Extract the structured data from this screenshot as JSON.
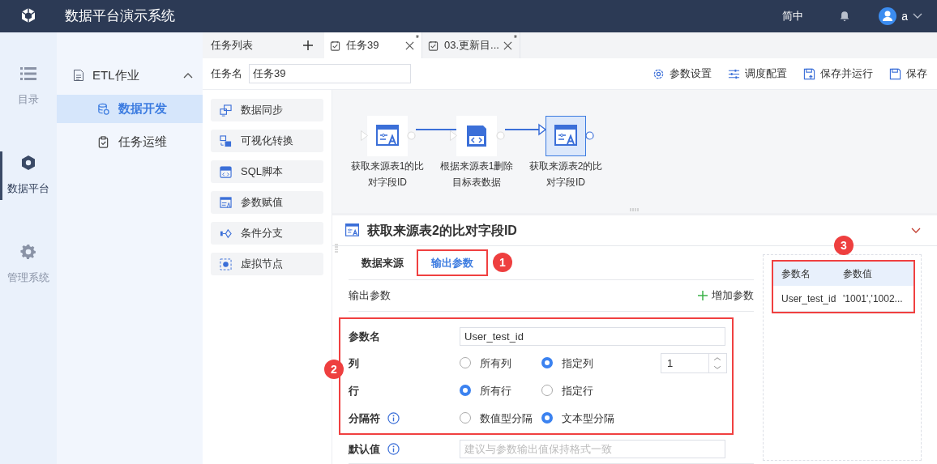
{
  "header": {
    "title": "数据平台演示系统",
    "language": "简中",
    "user": "a"
  },
  "rail": [
    {
      "label": "目录",
      "selected": false
    },
    {
      "label": "数据平台",
      "selected": true
    },
    {
      "label": "管理系统",
      "selected": false
    }
  ],
  "nav": {
    "group": {
      "label": "ETL作业",
      "expanded": true
    },
    "items": [
      {
        "label": "数据开发",
        "selected": true
      },
      {
        "label": "任务运维",
        "selected": false
      }
    ]
  },
  "tab_bar": {
    "list_label": "任务列表",
    "tabs": [
      {
        "label": "任务39",
        "selected": true,
        "mark": "*"
      },
      {
        "label": "03.更新目...",
        "selected": false,
        "mark": "*"
      }
    ]
  },
  "task_name": {
    "label": "任务名",
    "value": "任务39"
  },
  "toolbar": [
    "参数设置",
    "调度配置",
    "保存并运行",
    "保存"
  ],
  "palette": [
    "数据同步",
    "可视化转换",
    "SQL脚本",
    "参数赋值",
    "条件分支",
    "虚拟节点"
  ],
  "flow": {
    "nodes": [
      {
        "label": "获取来源表1的比对字段ID",
        "kind": "assign",
        "selected": false
      },
      {
        "label": "根据来源表1删除目标表数据",
        "kind": "sql",
        "selected": false
      },
      {
        "label": "获取来源表2的比对字段ID",
        "kind": "assign",
        "selected": true
      }
    ]
  },
  "detail": {
    "title": "获取来源表2的比对字段ID",
    "expanded": true,
    "tabs": [
      {
        "label": "数据来源",
        "selected": false
      },
      {
        "label": "输出参数",
        "selected": true
      }
    ],
    "section": "输出参数",
    "add_button": "增加参数",
    "form": {
      "name": {
        "label": "参数名",
        "value": "User_test_id"
      },
      "rows": [
        {
          "label": "列",
          "info": false,
          "options": [
            {
              "label": "所有列",
              "selected": false
            },
            {
              "label": "指定列",
              "selected": true
            }
          ],
          "number": "1"
        },
        {
          "label": "行",
          "info": false,
          "options": [
            {
              "label": "所有行",
              "selected": true
            },
            {
              "label": "指定行",
              "selected": false
            }
          ]
        },
        {
          "label": "分隔符",
          "info": true,
          "options": [
            {
              "label": "数值型分隔",
              "selected": false
            },
            {
              "label": "文本型分隔",
              "selected": true
            }
          ]
        }
      ],
      "default": {
        "label": "默认值",
        "placeholder": "建议与参数输出值保持格式一致"
      }
    },
    "preview": {
      "columns": [
        "参数名",
        "参数值"
      ],
      "rows": [
        [
          "User_test_id",
          "'1001','1002..."
        ]
      ]
    }
  },
  "annotations": [
    "1",
    "2",
    "3"
  ]
}
